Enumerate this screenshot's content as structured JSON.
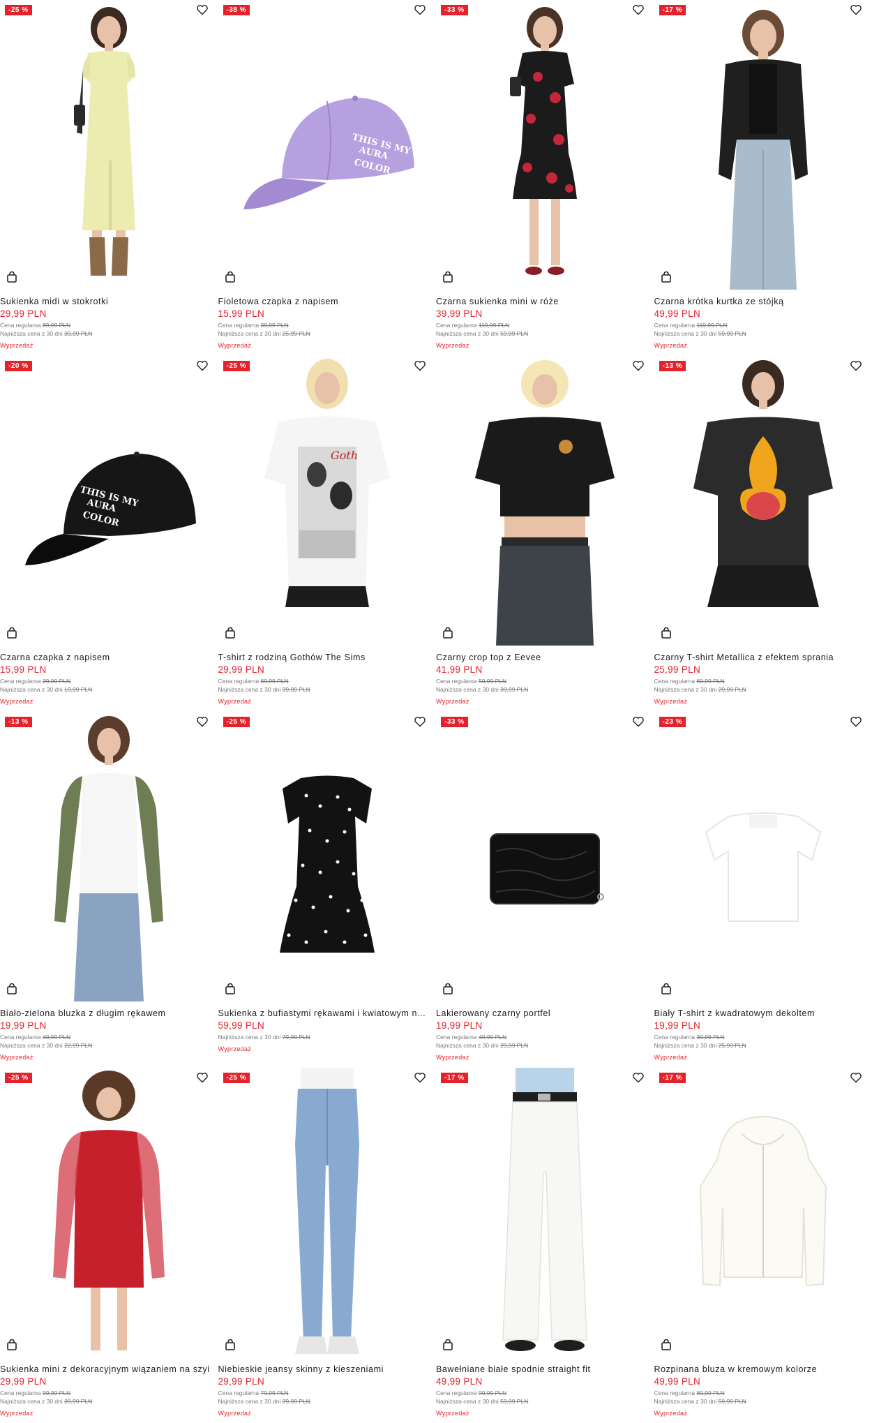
{
  "labels": {
    "regular": "Cena regularna",
    "lowest30": "Najniższa cena z 30 dni"
  },
  "colors": {
    "accent": "#e3222b"
  },
  "products": [
    {
      "badge": "-25 %",
      "name": "Sukienka midi w stokrotki",
      "price": "29,99 PLN",
      "regular": "89,99 PLN",
      "lowest": "39,99 PLN",
      "tag": "Wyprzedaż",
      "image": "yellow-floral-midi-dress"
    },
    {
      "badge": "-38 %",
      "name": "Fioletowa czapka z napisem",
      "price": "15,99 PLN",
      "regular": "39,99 PLN",
      "lowest": "25,99 PLN",
      "tag": "Wyprzedaż",
      "image": "purple-cap"
    },
    {
      "badge": "-33 %",
      "name": "Czarna sukienka mini w róże",
      "price": "39,99 PLN",
      "regular": "119,99 PLN",
      "lowest": "59,99 PLN",
      "tag": "Wyprzedaż",
      "image": "black-rose-mini-dress"
    },
    {
      "badge": "-17 %",
      "name": "Czarna krótka kurtka ze stójką",
      "price": "49,99 PLN",
      "regular": "119,99 PLN",
      "lowest": "59,99 PLN",
      "tag": "Wyprzedaż",
      "image": "black-cropped-jacket"
    },
    {
      "badge": "-20 %",
      "name": "Czarna czapka z napisem",
      "price": "15,99 PLN",
      "regular": "39,99 PLN",
      "lowest": "19,99 PLN",
      "tag": "Wyprzedaż",
      "image": "black-cap"
    },
    {
      "badge": "-25 %",
      "name": "T-shirt z rodziną Gothów The Sims",
      "price": "29,99 PLN",
      "regular": "69,99 PLN",
      "lowest": "39,99 PLN",
      "tag": "Wyprzedaż",
      "image": "white-sims-tshirt"
    },
    {
      "badge": "",
      "name": "Czarny crop top z Eevee",
      "price": "41,99 PLN",
      "regular": "59,99 PLN",
      "lowest": "39,99 PLN",
      "tag": "Wyprzedaż",
      "image": "black-crop-top"
    },
    {
      "badge": "-13 %",
      "name": "Czarny T-shirt Metallica z efektem sprania",
      "price": "25,99 PLN",
      "regular": "69,99 PLN",
      "lowest": "29,99 PLN",
      "tag": "Wyprzedaż",
      "image": "black-metallica-tshirt"
    },
    {
      "badge": "-13 %",
      "name": "Biało-zielona bluzka z długim rękawem",
      "price": "19,99 PLN",
      "regular": "49,99 PLN",
      "lowest": "22,99 PLN",
      "tag": "Wyprzedaż",
      "image": "white-green-raglan-top"
    },
    {
      "badge": "-25 %",
      "name": "Sukienka z bufiastymi rękawami i kwiatowym n...",
      "price": "59,99 PLN",
      "regular": "",
      "lowest": "79,99 PLN",
      "tag": "Wyprzedaż",
      "image": "black-polka-dot-dress"
    },
    {
      "badge": "-33 %",
      "name": "Lakierowany czarny portfel",
      "price": "19,99 PLN",
      "regular": "49,99 PLN",
      "lowest": "29,99 PLN",
      "tag": "Wyprzedaż",
      "image": "black-patent-wallet"
    },
    {
      "badge": "-23 %",
      "name": "Biały T-shirt z kwadratowym dekoltem",
      "price": "19,99 PLN",
      "regular": "39,99 PLN",
      "lowest": "25,99 PLN",
      "tag": "Wyprzedaż",
      "image": "white-square-neck-tshirt"
    },
    {
      "badge": "-25 %",
      "name": "Sukienka mini z dekoracyjnym wiązaniem na szyi",
      "price": "29,99 PLN",
      "regular": "99,99 PLN",
      "lowest": "39,99 PLN",
      "tag": "Wyprzedaż",
      "image": "red-mesh-mini-dress"
    },
    {
      "badge": "-25 %",
      "name": "Niebieskie jeansy skinny z kieszeniami",
      "price": "29,99 PLN",
      "regular": "79,99 PLN",
      "lowest": "39,99 PLN",
      "tag": "Wyprzedaż",
      "image": "blue-skinny-jeans"
    },
    {
      "badge": "-17 %",
      "name": "Bawełniane białe spodnie straight fit",
      "price": "49,99 PLN",
      "regular": "99,99 PLN",
      "lowest": "59,99 PLN",
      "tag": "Wyprzedaż",
      "image": "white-straight-trousers"
    },
    {
      "badge": "-17 %",
      "name": "Rozpinana bluza w kremowym kolorze",
      "price": "49,99 PLN",
      "regular": "89,99 PLN",
      "lowest": "59,99 PLN",
      "tag": "Wyprzedaż",
      "image": "cream-zip-hoodie"
    }
  ]
}
